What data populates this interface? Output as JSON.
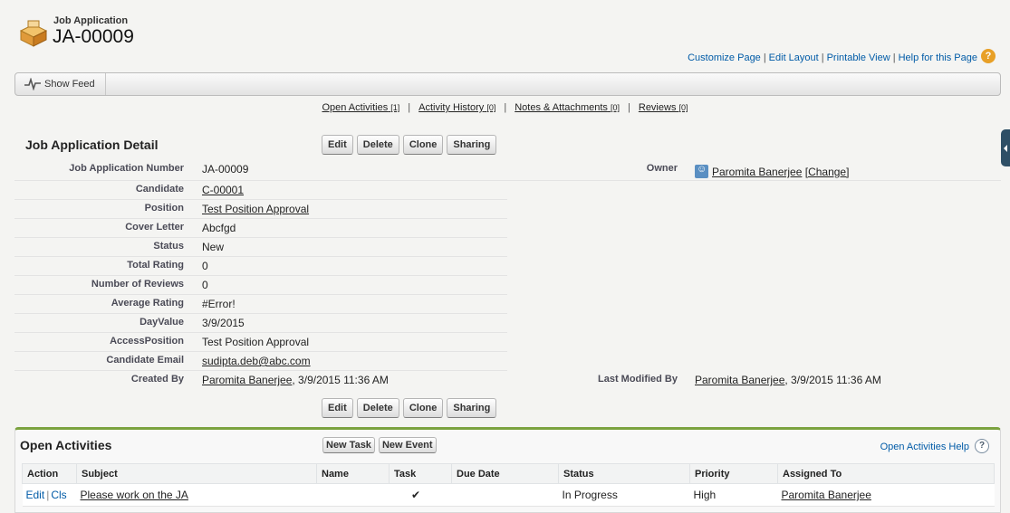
{
  "header": {
    "record_type": "Job Application",
    "record_name": "JA-00009",
    "links": [
      "Customize Page",
      "Edit Layout",
      "Printable View",
      "Help for this Page"
    ],
    "help_icon": "?"
  },
  "feed": {
    "show_feed_label": "Show Feed"
  },
  "related_links": [
    {
      "label": "Open Activities",
      "count": "[1]"
    },
    {
      "label": "Activity History",
      "count": "[0]"
    },
    {
      "label": "Notes & Attachments",
      "count": "[0]"
    },
    {
      "label": "Reviews",
      "count": "[0]"
    }
  ],
  "related_sep": "|",
  "detail": {
    "title": "Job Application Detail",
    "buttons": [
      "Edit",
      "Delete",
      "Clone",
      "Sharing"
    ],
    "fields": [
      {
        "label": "Job Application Number",
        "value": "JA-00009"
      },
      {
        "label": "Candidate",
        "value": "C-00001"
      },
      {
        "label": "Position",
        "value": "Test Position Approval"
      },
      {
        "label": "Cover Letter",
        "value": "Abcfgd"
      },
      {
        "label": "Status",
        "value": "New"
      },
      {
        "label": "Total Rating",
        "value": "0"
      },
      {
        "label": "Number of Reviews",
        "value": "0"
      },
      {
        "label": "Average Rating",
        "value": "#Error!"
      },
      {
        "label": "DayValue",
        "value": "3/9/2015"
      },
      {
        "label": "AccessPosition",
        "value": "Test Position Approval"
      },
      {
        "label": "Candidate Email",
        "value": "sudipta.deb@abc.com"
      }
    ],
    "owner": {
      "label": "Owner",
      "name": "Paromita Banerjee",
      "change": "[Change]"
    },
    "created_by": {
      "label": "Created By",
      "name": "Paromita Banerjee",
      "date": ", 3/9/2015 11:36 AM"
    },
    "modified_by": {
      "label": "Last Modified By",
      "name": "Paromita Banerjee",
      "date": ", 3/9/2015 11:36 AM"
    }
  },
  "open_activities": {
    "title": "Open Activities",
    "new_task": "New Task",
    "new_event": "New Event",
    "help": "Open Activities Help",
    "help_icon": "?",
    "columns": [
      "Action",
      "Subject",
      "Name",
      "Task",
      "Due Date",
      "Status",
      "Priority",
      "Assigned To"
    ],
    "rows": [
      {
        "edit": "Edit",
        "sep": "|",
        "close": "Cls",
        "subject": "Please work on the JA",
        "name": "",
        "task": "✔",
        "due": "",
        "status": "In Progress",
        "priority": "High",
        "assigned": "Paromita Banerjee"
      }
    ]
  }
}
